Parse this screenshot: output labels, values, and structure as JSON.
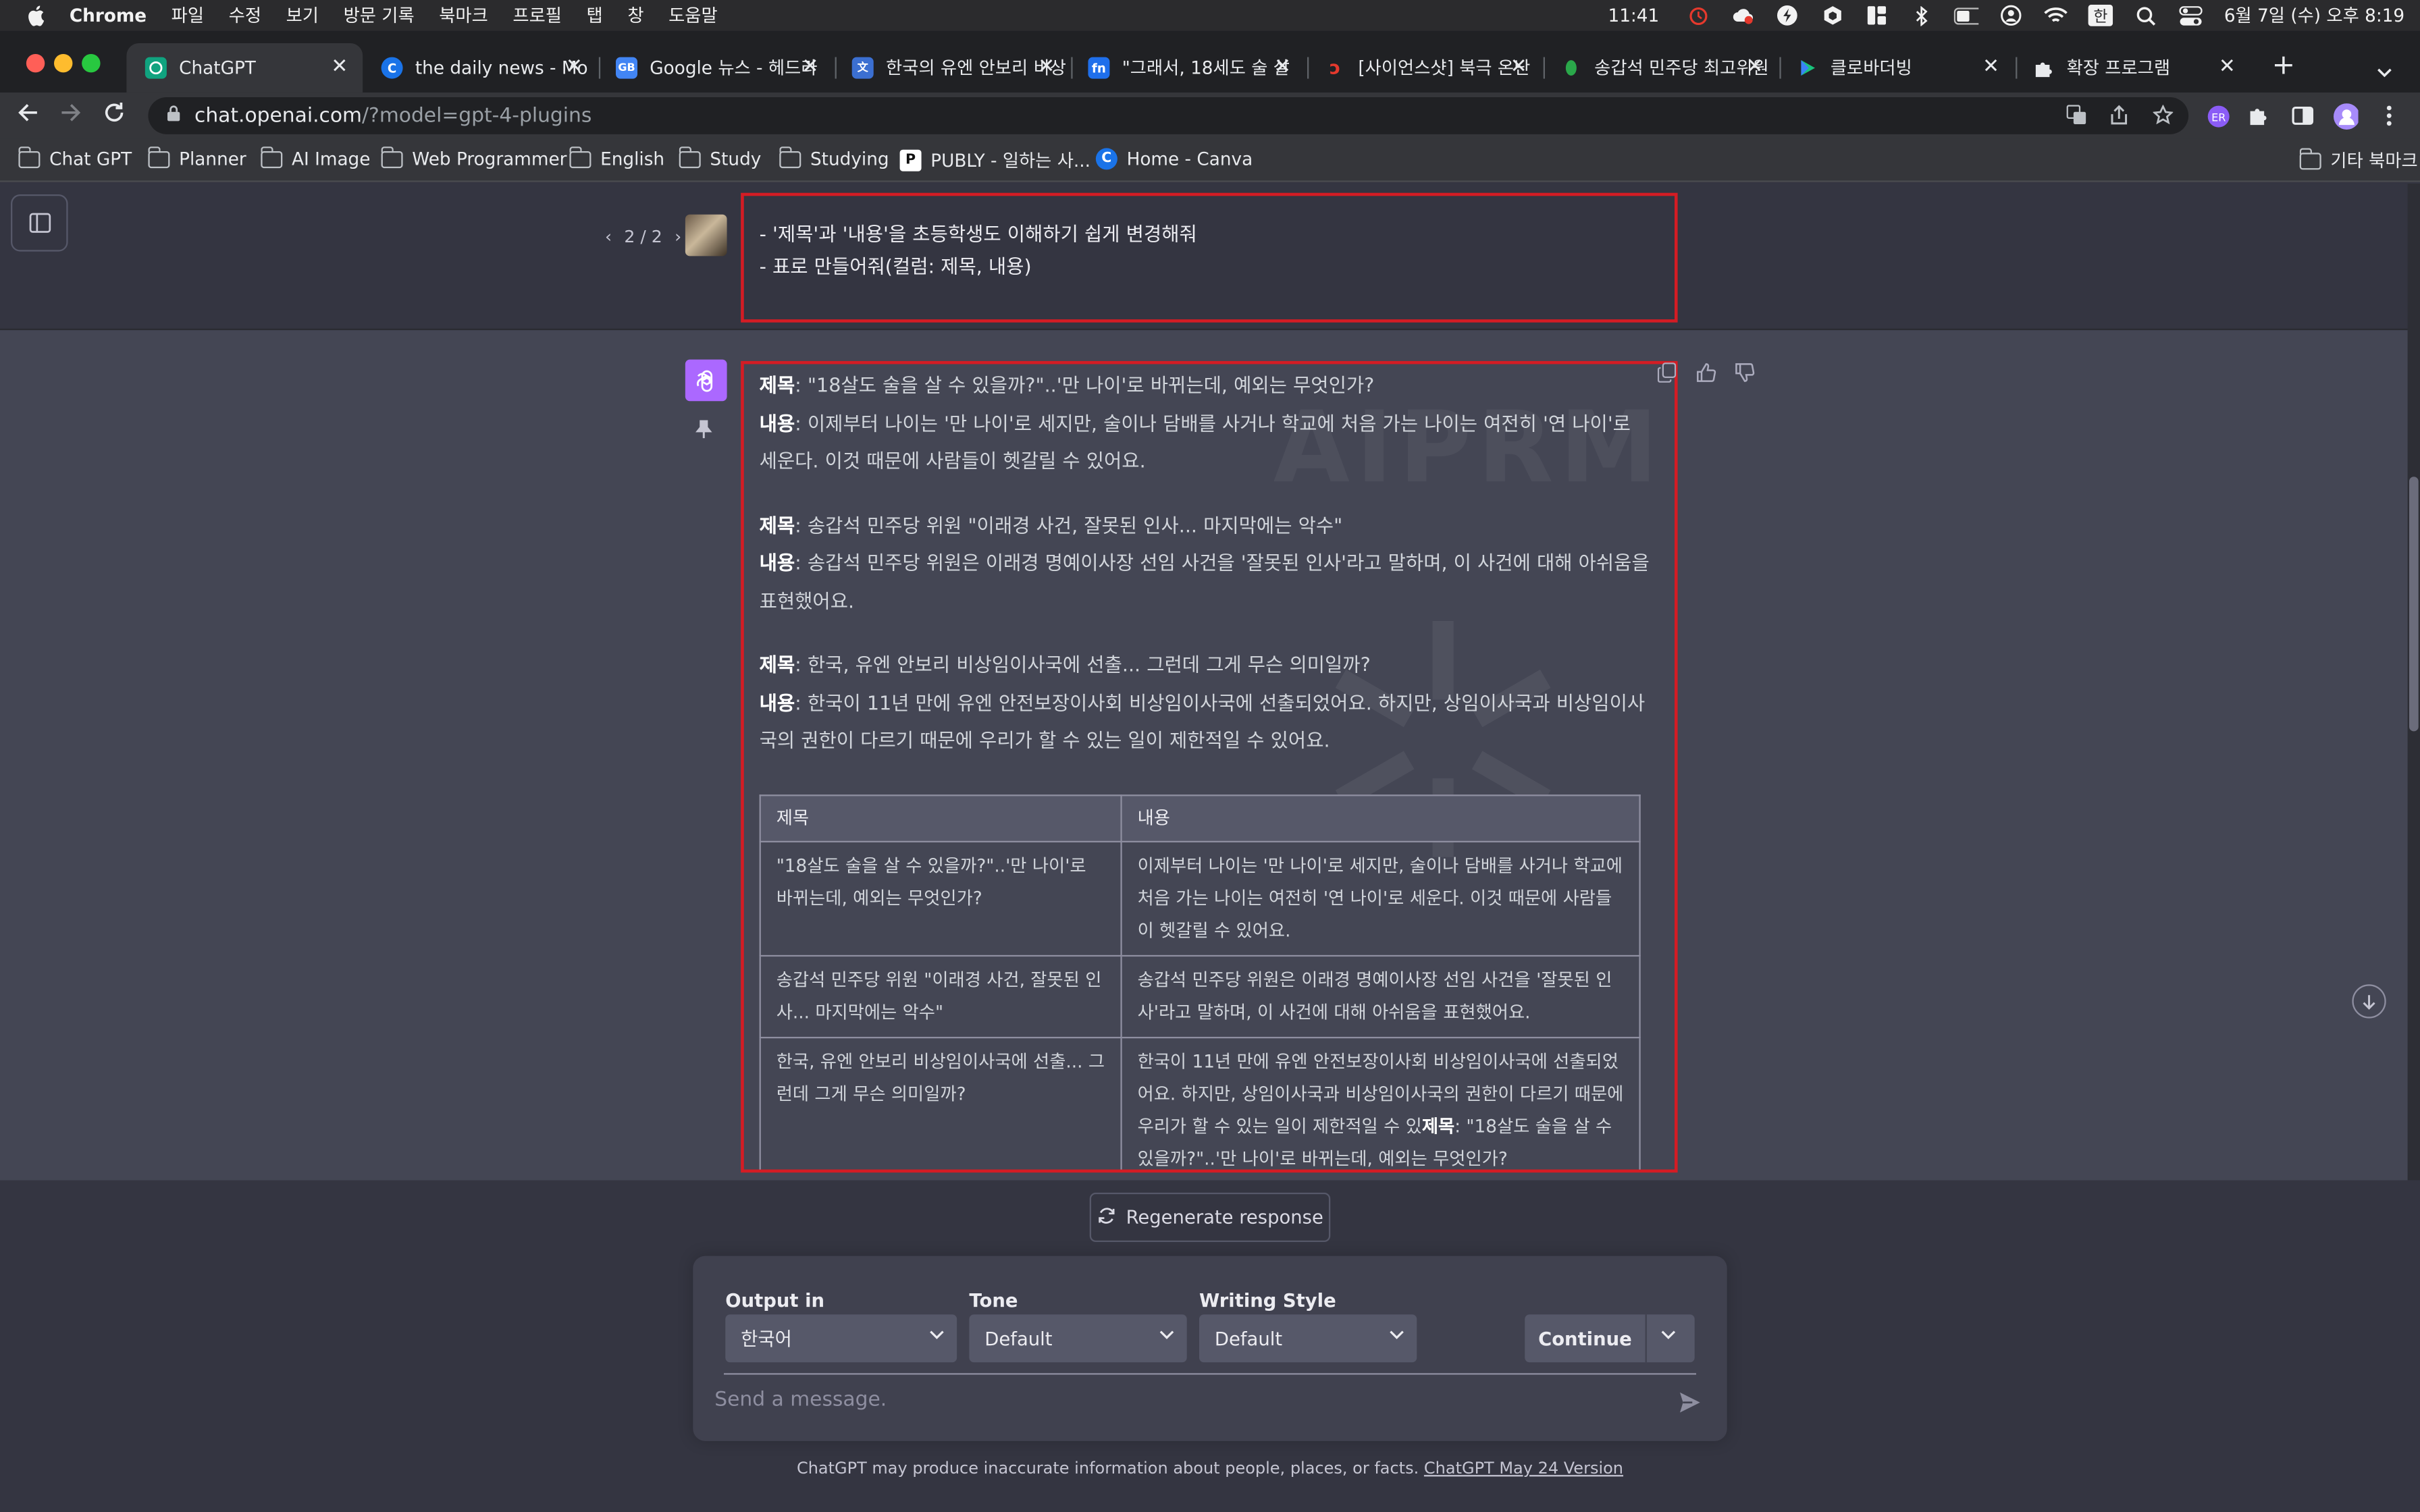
{
  "menubar": {
    "app": "Chrome",
    "menus": [
      "파일",
      "수정",
      "보기",
      "방문 기록",
      "북마크",
      "프로필",
      "탭",
      "창",
      "도움말"
    ],
    "time": "11:41",
    "date": "6월 7일 (수) 오후 8:19"
  },
  "tabs": [
    {
      "title": "ChatGPT",
      "fav_color": "#10a37f"
    },
    {
      "title": "the daily news - Mo",
      "fav_color": "#1a73e8"
    },
    {
      "title": "Google 뉴스 - 헤드라",
      "fav_color": "#4285f4"
    },
    {
      "title": "한국의 유엔 안보리 비상",
      "fav_color": "#3b6fd1"
    },
    {
      "title": "\"그래서, 18세도 술 살",
      "fav_color": "#1f6feb"
    },
    {
      "title": "[사이언스샷] 북극 온난",
      "fav_color": "#e5392d"
    },
    {
      "title": "송갑석 민주당 최고위원",
      "fav_color": "#2aa84a"
    },
    {
      "title": "클로바더빙",
      "fav_color": "#19c37d"
    },
    {
      "title": "확장 프로그램",
      "fav_color": "#9aa0a6"
    }
  ],
  "address": {
    "host": "chat.openai.com",
    "path": "/?model=gpt-4-plugins"
  },
  "bookmarks": [
    {
      "label": "Chat GPT",
      "type": "folder"
    },
    {
      "label": "Planner",
      "type": "folder"
    },
    {
      "label": "AI Image",
      "type": "folder"
    },
    {
      "label": "Web Programmer",
      "type": "folder"
    },
    {
      "label": "English",
      "type": "folder"
    },
    {
      "label": "Study",
      "type": "folder"
    },
    {
      "label": "Studying",
      "type": "folder"
    },
    {
      "label": "PUBLY - 일하는 사...",
      "type": "site"
    },
    {
      "label": "Home - Canva",
      "type": "site"
    },
    {
      "label": "기타 북마크",
      "type": "folder"
    }
  ],
  "conversation": {
    "pager": "2 / 2",
    "user_line_1": "- '제목'과 '내용'을 초등학생도 이해하기 쉽게 변경해줘",
    "user_line_2": "- 표로 만들어줘(컬럼: 제목, 내용)",
    "watermark": "AIPRM",
    "title_label": "제목",
    "content_label": "내용",
    "items": [
      {
        "title": ": \"18살도 술을 살 수 있을까?\"..'만 나이'로 바뀌는데, 예외는 무엇인가?",
        "content": ": 이제부터 나이는 '만 나이'로 세지만, 술이나 담배를 사거나 학교에 처음 가는 나이는 여전히 '연 나이'로 세운다. 이것 때문에 사람들이 헷갈릴 수 있어요."
      },
      {
        "title": ": 송갑석 민주당 위원 \"이래경 사건, 잘못된 인사... 마지막에는 악수\"",
        "content": ": 송갑석 민주당 위원은 이래경 명예이사장 선임 사건을 '잘못된 인사'라고 말하며, 이 사건에 대해 아쉬움을 표현했어요."
      },
      {
        "title": ": 한국, 유엔 안보리 비상임이사국에 선출... 그런데 그게 무슨 의미일까?",
        "content": ": 한국이 11년 만에 유엔 안전보장이사회 비상임이사국에 선출되었어요. 하지만, 상임이사국과 비상임이사국의 권한이 다르기 때문에 우리가 할 수 있는 일이 제한적일 수 있어요."
      }
    ],
    "table": {
      "headers": [
        "제목",
        "내용"
      ],
      "rows": [
        [
          "\"18살도 술을 살 수 있을까?\"..'만 나이'로 바뀌는데, 예외는 무엇인가?",
          "이제부터 나이는 '만 나이'로 세지만, 술이나 담배를 사거나 학교에 처음 가는 나이는 여전히 '연 나이'로 세운다. 이것 때문에 사람들이 헷갈릴 수 있어요."
        ],
        [
          "송갑석 민주당 위원 \"이래경 사건, 잘못된 인사... 마지막에는 악수\"",
          "송갑석 민주당 위원은 이래경 명예이사장 선임 사건을 '잘못된 인사'라고 말하며, 이 사건에 대해 아쉬움을 표현했어요."
        ],
        [
          "한국, 유엔 안보리 비상임이사국에 선출... 그런데 그게 무슨 의미일까?",
          "한국이 11년 만에 유엔 안전보장이사회 비상임이사국에 선출되었어요. 하지만, 상임이사국과 비상임이사국의 권한이 다르기 때문에 우리가 할 수 있는 일이 제한적일 수 있"
        ]
      ],
      "row3_bold": "제목",
      "row3_tail": ": \"18살도 술을 살 수 있을까?\"..'만 나이'로 바뀌는데, 예외는 무엇인가?"
    }
  },
  "composer": {
    "regenerate": "Regenerate response",
    "output_label": "Output in",
    "output_value": "한국어",
    "tone_label": "Tone",
    "tone_value": "Default",
    "style_label": "Writing Style",
    "style_value": "Default",
    "continue": "Continue",
    "placeholder": "Send a message.",
    "disclaimer": "ChatGPT may produce inaccurate information about people, places, or facts.",
    "version_link": "ChatGPT May 24 Version"
  },
  "colors": {
    "highlight_border": "#d41c24",
    "gpt_avatar": "#ab68ff",
    "assistant_bg": "#444654"
  }
}
